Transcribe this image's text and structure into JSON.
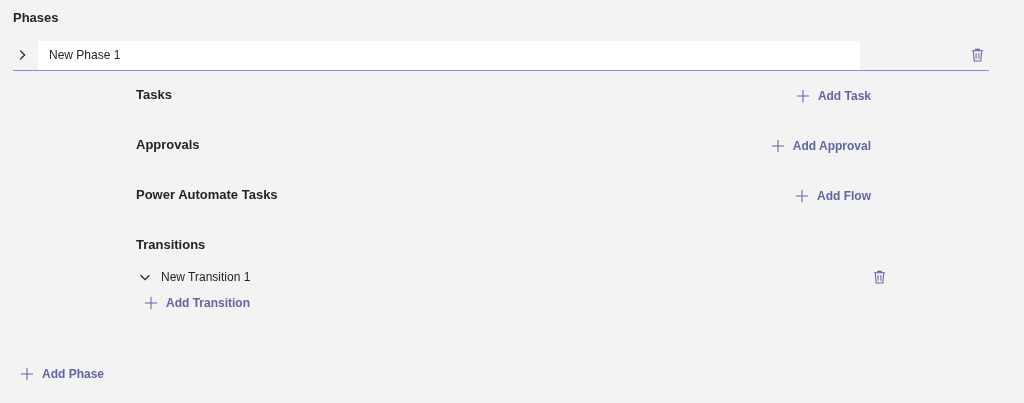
{
  "title": "Phases",
  "phases": [
    {
      "name": "New Phase 1",
      "expanded": false,
      "sections": [
        {
          "title": "Tasks",
          "action": "Add Task"
        },
        {
          "title": "Approvals",
          "action": "Add Approval"
        },
        {
          "title": "Power Automate Tasks",
          "action": "Add Flow"
        }
      ],
      "transitions": {
        "title": "Transitions",
        "items": [
          {
            "name": "New Transition 1",
            "expanded": true
          }
        ],
        "action": "Add Transition"
      }
    }
  ],
  "add_phase": "Add Phase"
}
